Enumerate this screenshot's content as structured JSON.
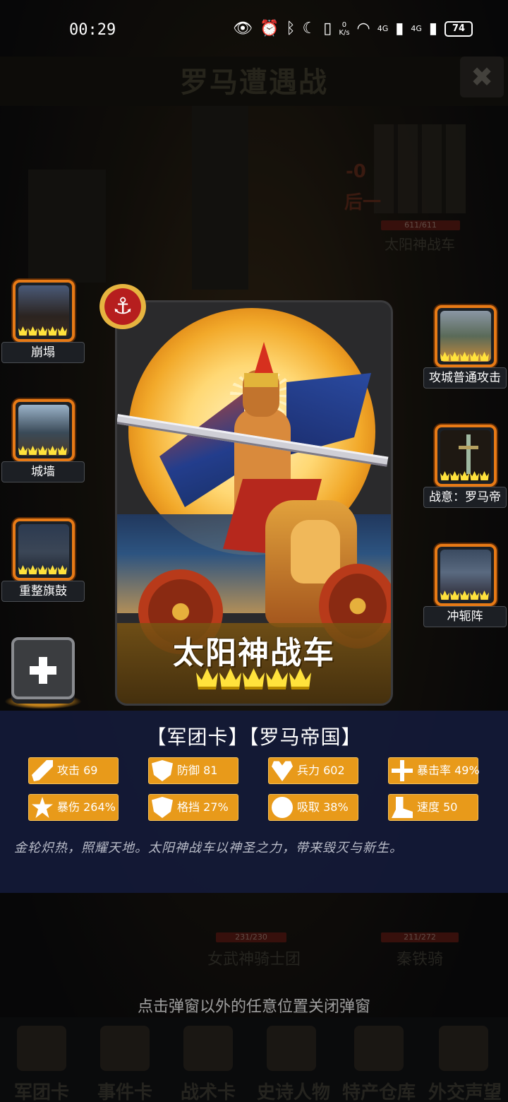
{
  "status_bar": {
    "time": "00:29",
    "net_speed_top": "0",
    "net_speed_unit": "K/s",
    "signal1": "4G",
    "signal2": "4G",
    "battery": "74"
  },
  "background": {
    "title": "罗马遭遇战",
    "close_symbol": "✖",
    "enemy_hp": "611/611",
    "enemy_name": "太阳神战车",
    "side_num_a": "-0",
    "side_num_b": "后一",
    "unit_left_hp": "231/230",
    "unit_left_name": "女武神骑士团",
    "unit_right_hp": "211/272",
    "unit_right_name": "秦铁骑",
    "hint": "点击弹窗以外的任意位置关闭弹窗",
    "nav": [
      "军团卡",
      "事件卡",
      "战术卡",
      "史诗人物",
      "特产仓库",
      "外交声望"
    ]
  },
  "card": {
    "name": "太阳神战车",
    "stars": 5,
    "badge_icon": "anchor-icon"
  },
  "left_skills": [
    {
      "label": "崩塌",
      "pic": "ruins-tower"
    },
    {
      "label": "城墙",
      "pic": "city-wall"
    },
    {
      "label": "重整旗鼓",
      "pic": "armored-knights"
    }
  ],
  "right_skills": [
    {
      "label": "攻城普通攻击",
      "pic": "siege-cannon"
    },
    {
      "label": "战意：罗马帝",
      "pic": "sword"
    },
    {
      "label": "冲轭阵",
      "pic": "warrior-gate"
    }
  ],
  "add_button": {
    "symbol": "+"
  },
  "info": {
    "title": "【军团卡】【罗马帝国】",
    "stats": [
      {
        "label": "攻击 69",
        "icon": "sword-icon"
      },
      {
        "label": "防御 81",
        "icon": "shield-icon"
      },
      {
        "label": "兵力 602",
        "icon": "heart-icon"
      },
      {
        "label": "暴击率 49%",
        "icon": "crosshair-icon"
      },
      {
        "label": "暴伤 264%",
        "icon": "burst-icon"
      },
      {
        "label": "格挡 27%",
        "icon": "block-icon"
      },
      {
        "label": "吸取 38%",
        "icon": "absorb-icon"
      },
      {
        "label": "速度 50",
        "icon": "boot-icon"
      }
    ],
    "description": "金轮炽热，照耀天地。太阳神战车以神圣之力，带来毁灭与新生。"
  },
  "colors": {
    "accent": "#e89a1a",
    "panel": "#141a38",
    "frame": "#e77a16",
    "star": "#ffe23c"
  }
}
